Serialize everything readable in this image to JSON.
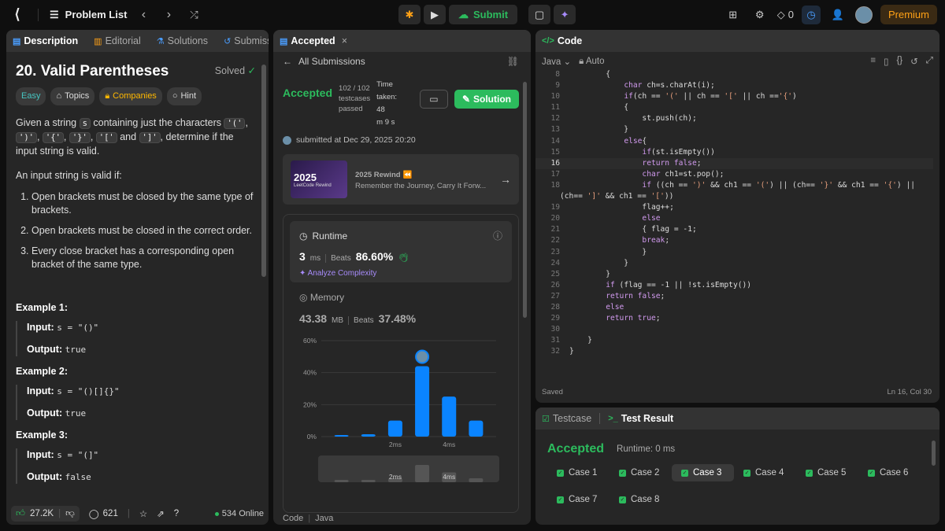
{
  "topbar": {
    "problem_list": "Problem List",
    "submit_label": "Submit",
    "streak": "0",
    "premium": "Premium"
  },
  "description": {
    "tabs": [
      "Description",
      "Editorial",
      "Solutions",
      "Submissions"
    ],
    "title": "20. Valid Parentheses",
    "solved": "Solved",
    "chips": [
      "Easy",
      "Topics",
      "Companies",
      "Hint"
    ],
    "intro": {
      "t1": "Given a string ",
      "s": "s",
      "t2": " containing just the characters ",
      "c1": "'('",
      "c2": "')'",
      "c3": "'{'",
      "c4": "'}'",
      "c5": "'['",
      "t3": " and ",
      "c6": "']'",
      "t4": ", determine if the input string is valid."
    },
    "valid_text": "An input string is valid if:",
    "rules": [
      "Open brackets must be closed by the same type of brackets.",
      "Open brackets must be closed in the correct order.",
      "Every close bracket has a corresponding open bracket of the same type."
    ],
    "examples": [
      {
        "title": "Example 1:",
        "input": "s = \"()\"",
        "output": "true"
      },
      {
        "title": "Example 2:",
        "input": "s = \"()[]{}\"",
        "output": "true"
      },
      {
        "title": "Example 3:",
        "input": "s = \"(]\"",
        "output": "false"
      }
    ],
    "input_label": "Input:",
    "output_label": "Output:",
    "likes": "27.2K",
    "comments": "621",
    "online": "534 Online"
  },
  "accepted": {
    "tab": "Accepted",
    "back": "All Submissions",
    "status": "Accepted",
    "testcases_l1": "102 / 102",
    "testcases_l2": "testcases",
    "testcases_l3": "passed",
    "time_l1": "Time",
    "time_l2": "taken: 48",
    "time_l3": "m 9 s",
    "solution": "Solution",
    "submitted": "submitted at Dec 29, 2025 20:20",
    "rewind_img_title": "2025",
    "rewind_img_sub": "LeetCode Rewind",
    "rewind_title": "2025 Rewind",
    "rewind_sub": "Remember the Journey, Carry It Forw...",
    "runtime_label": "Runtime",
    "runtime_value": "3",
    "runtime_unit": "ms",
    "runtime_beats_label": "Beats",
    "runtime_beats": "86.60%",
    "analyze": "Analyze Complexity",
    "memory_label": "Memory",
    "memory_value": "43.38",
    "memory_unit": "MB",
    "memory_beats_label": "Beats",
    "memory_beats": "37.48%",
    "footer_code": "Code",
    "footer_lang": "Java"
  },
  "chart_data": {
    "type": "bar",
    "ylim": [
      0,
      60
    ],
    "yticks": [
      "0%",
      "20%",
      "40%",
      "60%"
    ],
    "xticks": [
      "2ms",
      "4ms"
    ],
    "values": [
      1,
      1.5,
      10,
      44,
      25,
      10
    ],
    "overview_xticks": [
      "2ms",
      "4ms"
    ]
  },
  "code": {
    "title": "Code",
    "lang": "Java",
    "auto": "Auto",
    "saved": "Saved",
    "cursor": "Ln 16, Col 30",
    "lines": [
      {
        "n": "8",
        "t": "        {"
      },
      {
        "n": "9",
        "t": "            char ch=s.charAt(i);"
      },
      {
        "n": "10",
        "t": "            if(ch == '(' || ch == '[' || ch =='{')"
      },
      {
        "n": "11",
        "t": "            {"
      },
      {
        "n": "12",
        "t": "                st.push(ch);"
      },
      {
        "n": "13",
        "t": "            }"
      },
      {
        "n": "14",
        "t": "            else{"
      },
      {
        "n": "15",
        "t": "                if(st.isEmpty())"
      },
      {
        "n": "16",
        "t": "                return false;"
      },
      {
        "n": "17",
        "t": "                char ch1=st.pop();"
      },
      {
        "n": "18",
        "t": "                if ((ch == ')' && ch1 == '(') || (ch== '}' && ch1 == '{') ||"
      },
      {
        "n": "",
        "t": "(ch== ']' && ch1 == '['))"
      },
      {
        "n": "19",
        "t": "                flag++;"
      },
      {
        "n": "20",
        "t": "                else"
      },
      {
        "n": "21",
        "t": "                { flag = -1;"
      },
      {
        "n": "22",
        "t": "                break;"
      },
      {
        "n": "23",
        "t": "                }"
      },
      {
        "n": "24",
        "t": "            }"
      },
      {
        "n": "25",
        "t": "        }"
      },
      {
        "n": "26",
        "t": "        if (flag == -1 || !st.isEmpty())"
      },
      {
        "n": "27",
        "t": "        return false;"
      },
      {
        "n": "28",
        "t": "        else"
      },
      {
        "n": "29",
        "t": "        return true;"
      },
      {
        "n": "30",
        "t": ""
      },
      {
        "n": "31",
        "t": "    }"
      },
      {
        "n": "32",
        "t": "}"
      }
    ]
  },
  "result": {
    "tab_testcase": "Testcase",
    "tab_result": "Test Result",
    "status": "Accepted",
    "runtime": "Runtime: 0 ms",
    "cases": [
      "Case 1",
      "Case 2",
      "Case 3",
      "Case 4",
      "Case 5",
      "Case 6",
      "Case 7",
      "Case 8"
    ]
  }
}
